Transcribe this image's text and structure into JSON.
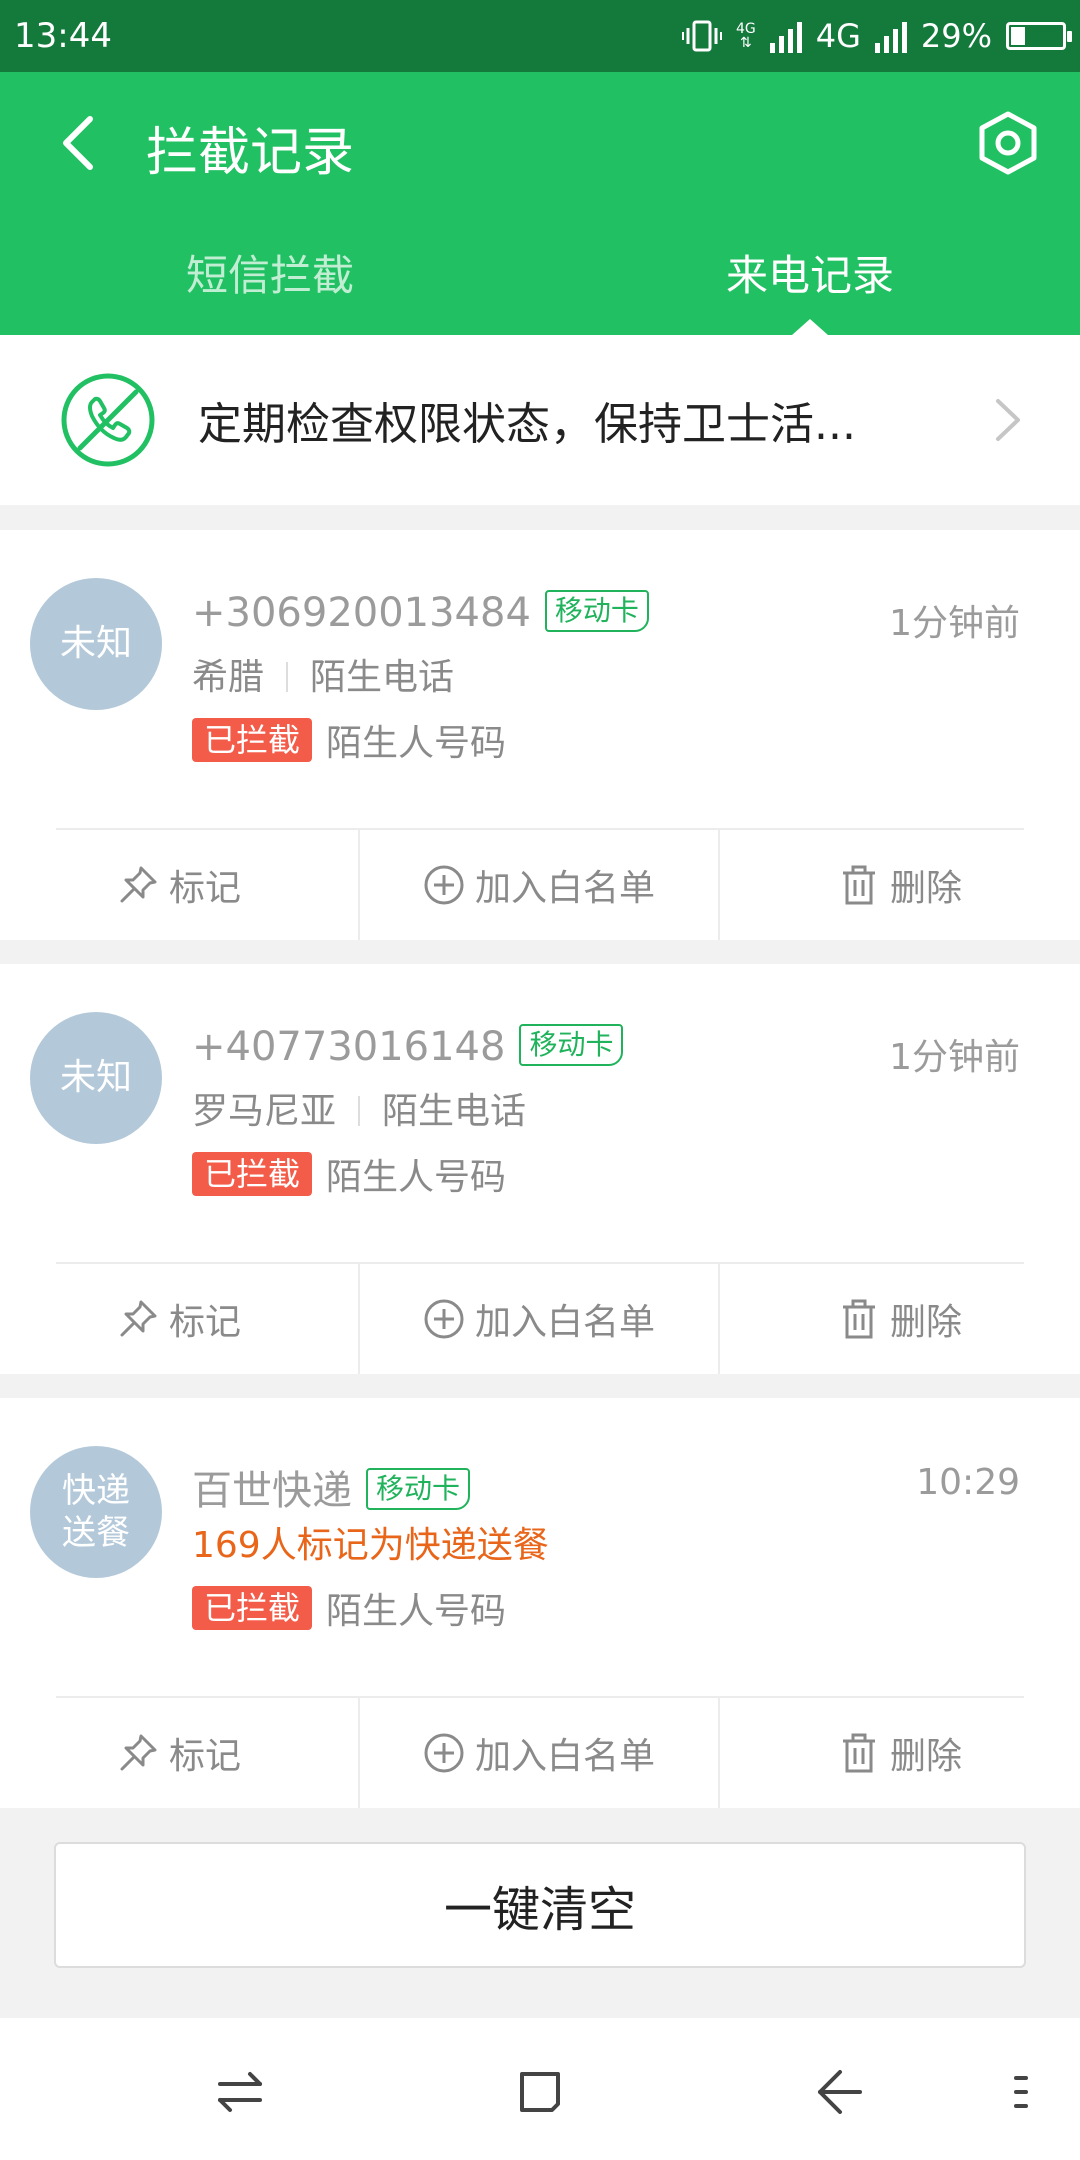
{
  "status_bar": {
    "time": "13:44",
    "net_small": "4G",
    "net_large": "4G",
    "battery": "29%",
    "battery_level": 0.29
  },
  "header": {
    "title": "拦截记录",
    "tabs": [
      {
        "label": "短信拦截",
        "active": false
      },
      {
        "label": "来电记录",
        "active": true
      }
    ]
  },
  "banner": {
    "text": "定期检查权限状态，保持卫士活..."
  },
  "records": [
    {
      "avatar": "未知",
      "name": "+306920013484",
      "sim": "移动卡",
      "time": "1分钟前",
      "location": "希腊",
      "type": "陌生电话",
      "status": "已拦截",
      "status_desc": "陌生人号码"
    },
    {
      "avatar": "未知",
      "name": "+40773016148",
      "sim": "移动卡",
      "time": "1分钟前",
      "location": "罗马尼亚",
      "type": "陌生电话",
      "status": "已拦截",
      "status_desc": "陌生人号码"
    },
    {
      "avatar_line1": "快递",
      "avatar_line2": "送餐",
      "name": "百世快递",
      "sim": "移动卡",
      "time": "10:29",
      "tag_note": "169人标记为快递送餐",
      "status": "已拦截",
      "status_desc": "陌生人号码"
    }
  ],
  "actions": {
    "mark": "标记",
    "whitelist": "加入白名单",
    "delete": "删除"
  },
  "clear_button": "一键清空",
  "colors": {
    "header_green": "#21c063",
    "status_green": "#137a3c",
    "blocked_red": "#f45c4a",
    "note_orange": "#e8651a",
    "avatar_blue": "#b3c8d9"
  }
}
